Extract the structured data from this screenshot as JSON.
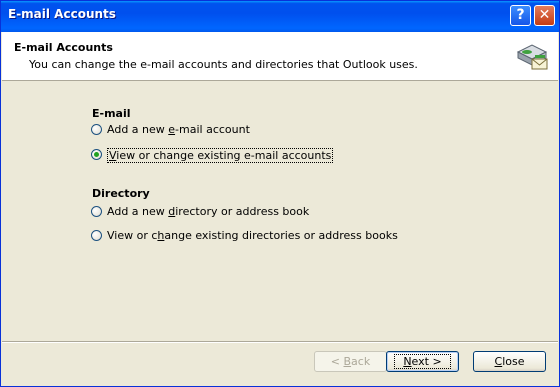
{
  "window": {
    "title": "E-mail Accounts",
    "help_glyph": "?",
    "close_glyph": "✕"
  },
  "header": {
    "title": "E-mail Accounts",
    "subtitle": "You can change the e-mail accounts and directories that Outlook uses."
  },
  "email_section": {
    "label": "E-mail",
    "options": [
      {
        "pre": "Add a new ",
        "key": "e",
        "post": "-mail account",
        "selected": false
      },
      {
        "pre": "",
        "key": "V",
        "post": "iew or change existing e-mail accounts",
        "selected": true
      }
    ]
  },
  "directory_section": {
    "label": "Directory",
    "options": [
      {
        "pre": "Add a new ",
        "key": "d",
        "post": "irectory or address book",
        "selected": false
      },
      {
        "pre": "View or c",
        "key": "h",
        "post": "ange existing directories or address books",
        "selected": false
      }
    ]
  },
  "buttons": {
    "back": {
      "pre": "< ",
      "key": "B",
      "post": "ack",
      "enabled": false
    },
    "next": {
      "pre": "",
      "key": "N",
      "post": "ext >",
      "enabled": true
    },
    "close": {
      "pre": "",
      "key": "C",
      "post": "lose",
      "enabled": true
    }
  },
  "colors": {
    "titlebar": "#0054e3",
    "dialog_bg": "#ece9d8",
    "radio_dot": "#21a121"
  },
  "icons": {
    "header": "email-accounts-icon",
    "help": "help-icon",
    "close": "close-icon"
  }
}
